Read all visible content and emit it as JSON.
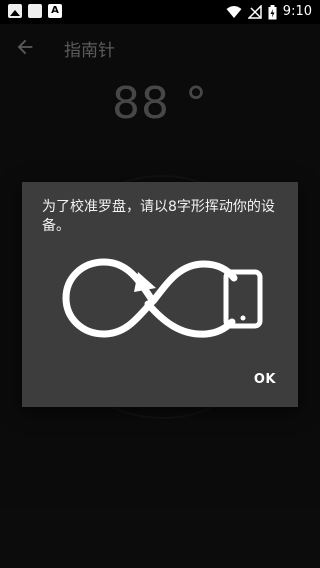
{
  "status_bar": {
    "time": "9:10",
    "left_icons": [
      "photo-icon",
      "square-icon",
      "a-icon"
    ],
    "right_icons": [
      "wifi-icon",
      "no-signal-icon",
      "battery-charging-icon"
    ]
  },
  "app_bar": {
    "back_icon": "arrow-left-icon",
    "title": "指南针"
  },
  "compass": {
    "heading": "88 °"
  },
  "dialog": {
    "message": "为了校准罗盘，请以8字形挥动你的设备。",
    "illustration": "figure-eight-phone-icon",
    "ok_label": "OK"
  }
}
